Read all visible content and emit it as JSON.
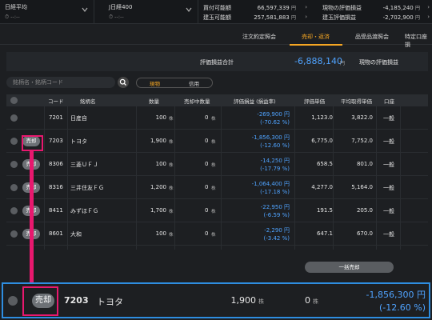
{
  "ticker": {
    "indices": [
      {
        "name": "日経平均",
        "selector": "--:--"
      },
      {
        "name": "J日経400",
        "selector": "--:--"
      }
    ],
    "balances": [
      {
        "label": "買付可能額",
        "value": "66,597,339",
        "unit": "円"
      },
      {
        "label": "建玉可能額",
        "value": "257,581,883",
        "unit": "円"
      }
    ],
    "pl": [
      {
        "label": "現物の評価損益",
        "value": "-4,185,240",
        "unit": "円"
      },
      {
        "label": "建玉評価損益",
        "value": "-2,702,900",
        "unit": "円"
      }
    ]
  },
  "tabs": [
    "注文約定照会",
    "売却・返済",
    "品受品渡照会",
    "特定口座損"
  ],
  "active_tab": "売却・返済",
  "summary": {
    "total_label": "評価損益合計",
    "total_value": "-6,888,140",
    "unit": "円",
    "spot_label": "現物の評価損益"
  },
  "search": {
    "placeholder": "銘柄名・銘柄コード"
  },
  "toggle": {
    "left": "現物",
    "right": "信用"
  },
  "table": {
    "headers": [
      "コード",
      "銘柄名",
      "数量",
      "売却中数量",
      "評価損益 (損益率)",
      "評価単価",
      "平均取得単価",
      "口座"
    ],
    "sell_label": "売却",
    "qty_unit": "株",
    "rows": [
      {
        "code": "7201",
        "name": "日産自",
        "qty": "100",
        "selling": "0",
        "pl": "-269,900 円",
        "pl_rate": "(-70.62 %)",
        "price": "1,123.0",
        "avg": "3,822.0",
        "account": "一般",
        "sell_button": false
      },
      {
        "code": "7203",
        "name": "トヨタ",
        "qty": "1,900",
        "selling": "0",
        "pl": "-1,856,300 円",
        "pl_rate": "(-12.60 %)",
        "price": "6,775.0",
        "avg": "7,752.0",
        "account": "一般",
        "sell_button": true
      },
      {
        "code": "8306",
        "name": "三菱ＵＦＪ",
        "qty": "100",
        "selling": "0",
        "pl": "-14,250 円",
        "pl_rate": "(-17.79 %)",
        "price": "658.5",
        "avg": "801.0",
        "account": "一般",
        "sell_button": true
      },
      {
        "code": "8316",
        "name": "三井住友ＦＧ",
        "qty": "1,200",
        "selling": "0",
        "pl": "-1,064,400 円",
        "pl_rate": "(-17.18 %)",
        "price": "4,277.0",
        "avg": "5,164.0",
        "account": "一般",
        "sell_button": true
      },
      {
        "code": "8411",
        "name": "みずほＦＧ",
        "qty": "1,700",
        "selling": "0",
        "pl": "-22,950 円",
        "pl_rate": "(-6.59 %)",
        "price": "191.5",
        "avg": "205.0",
        "account": "一般",
        "sell_button": true
      },
      {
        "code": "8601",
        "name": "大和",
        "qty": "100",
        "selling": "0",
        "pl": "-2,290 円",
        "pl_rate": "(-3.42 %)",
        "price": "647.1",
        "avg": "670.0",
        "account": "一般",
        "sell_button": true
      }
    ]
  },
  "bulk_sell": "一括売却",
  "zoom_row": {
    "sell_label": "売却",
    "code": "7203",
    "name": "トヨタ",
    "qty": "1,900",
    "qty_unit": "株",
    "selling": "0",
    "pl": "-1,856,300 円",
    "pl_rate": "(-12.60 %)"
  },
  "colors": {
    "accent": "#f5a623",
    "negative": "#4fa3ff",
    "highlight": "#e8186e",
    "zoom_border": "#2e8de0"
  }
}
